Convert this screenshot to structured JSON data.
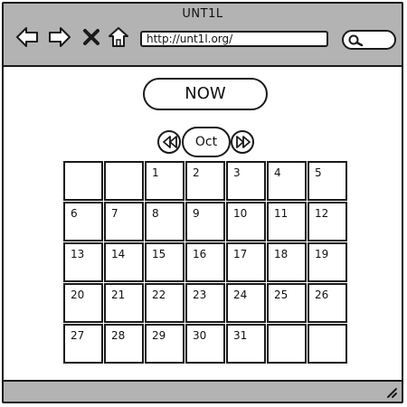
{
  "window": {
    "title": "UNT1L"
  },
  "toolbar": {
    "back_icon": "back-arrow-icon",
    "forward_icon": "forward-arrow-icon",
    "close_icon": "close-x-icon",
    "home_icon": "home-icon",
    "url": "http://unt1l.org/",
    "search_icon": "search-icon"
  },
  "main": {
    "now_label": "NOW",
    "month": "Oct",
    "calendar": [
      "",
      "",
      "1",
      "2",
      "3",
      "4",
      "5",
      "6",
      "7",
      "8",
      "9",
      "10",
      "11",
      "12",
      "13",
      "14",
      "15",
      "16",
      "17",
      "18",
      "19",
      "20",
      "21",
      "22",
      "23",
      "24",
      "25",
      "26",
      "27",
      "28",
      "29",
      "30",
      "31",
      "",
      ""
    ]
  },
  "colors": {
    "chrome": "#b3b3b3",
    "stroke": "#1a1a1a",
    "background": "#ffffff"
  }
}
